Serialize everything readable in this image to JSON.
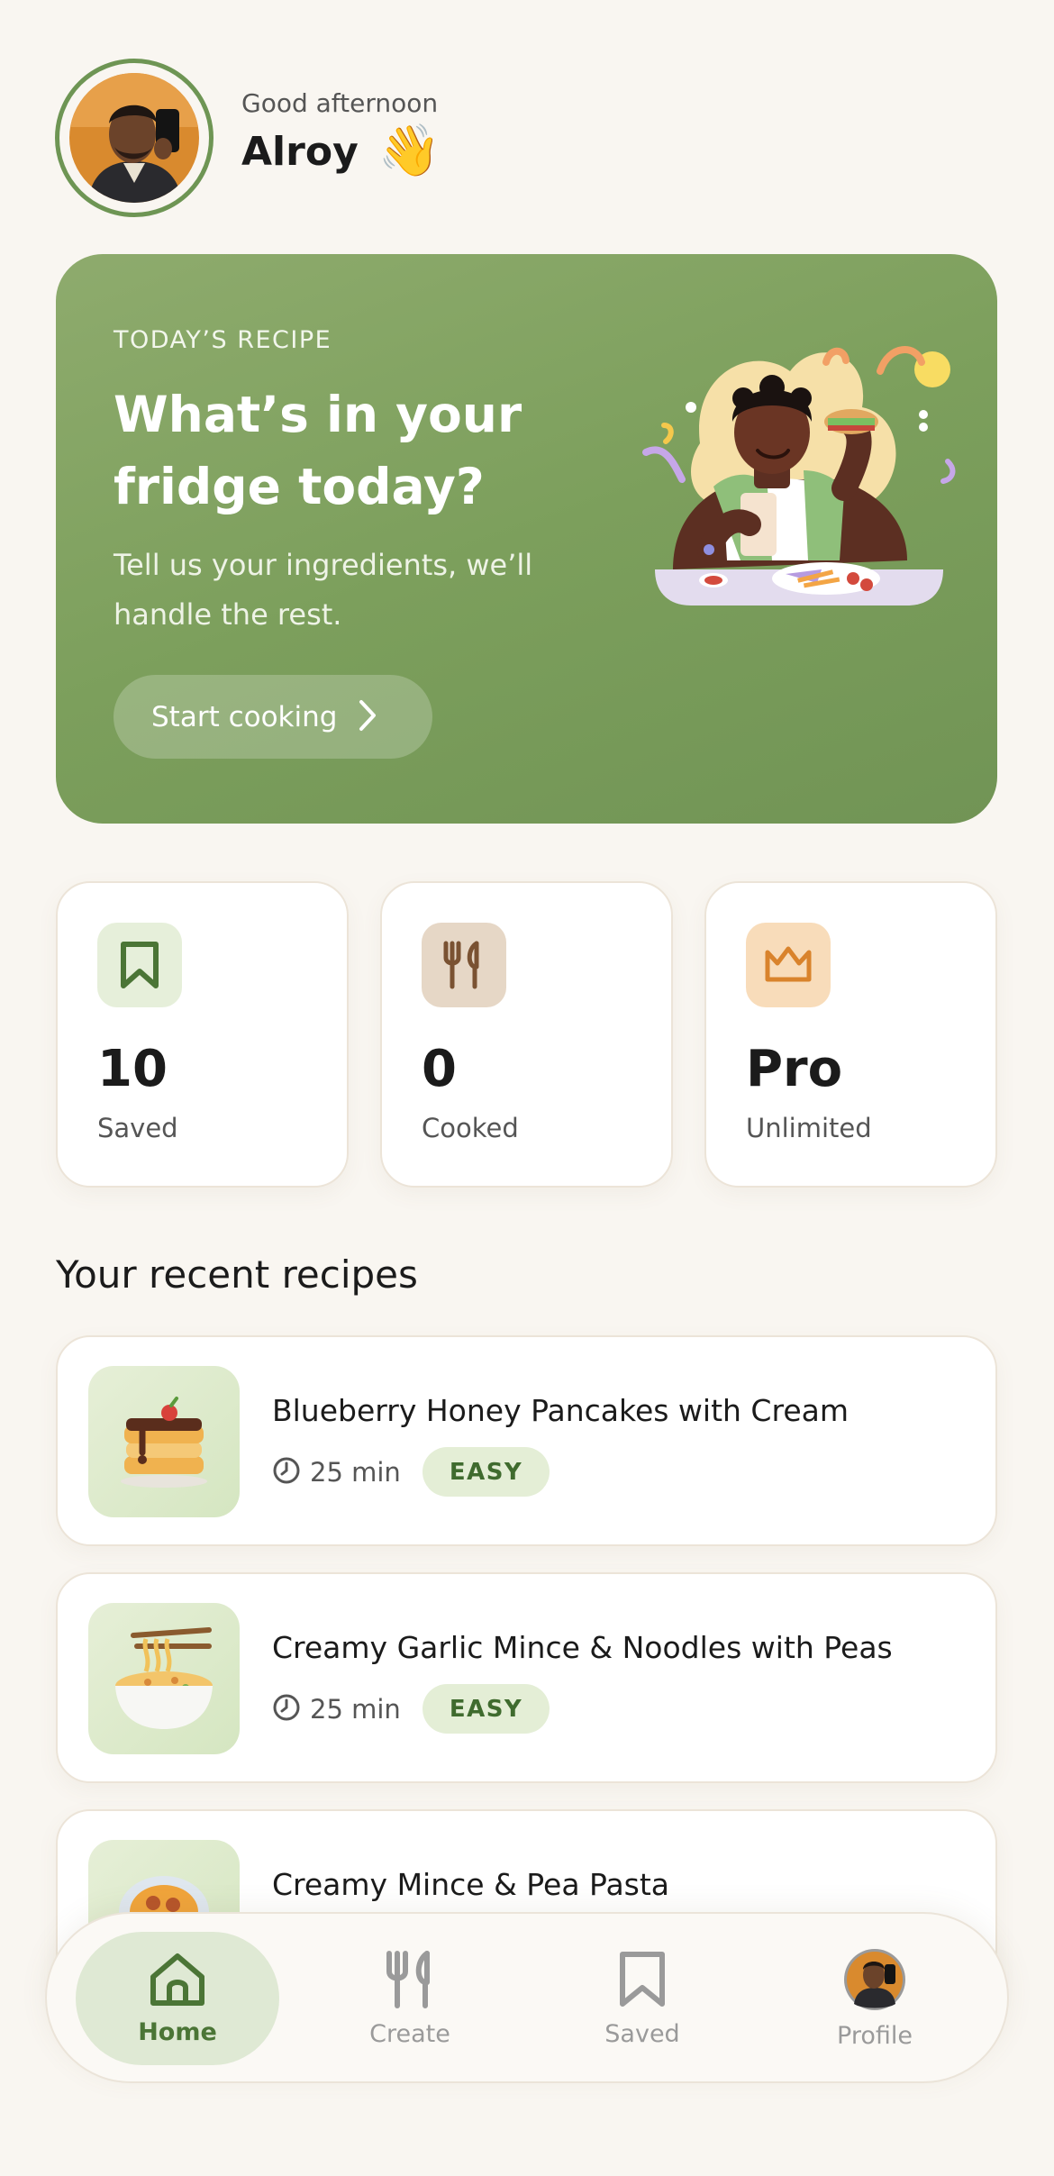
{
  "header": {
    "greeting": "Good afternoon",
    "user_name": "Alroy",
    "wave_emoji": "👋"
  },
  "hero": {
    "eyebrow": "TODAY’S RECIPE",
    "title": "What’s in your fridge today?",
    "subtitle": "Tell us your ingredients, we’ll handle the rest.",
    "cta_label": "Start cooking"
  },
  "stats": [
    {
      "icon": "bookmark-icon",
      "value": "10",
      "label": "Saved",
      "icon_bg": "#e6efda",
      "icon_color": "#4b7536"
    },
    {
      "icon": "utensils-icon",
      "value": "0",
      "label": "Cooked",
      "icon_bg": "#e6d7c6",
      "icon_color": "#7a5232"
    },
    {
      "icon": "crown-icon",
      "value": "Pro",
      "label": "Unlimited",
      "icon_bg": "#f8dcba",
      "icon_color": "#d9832c"
    }
  ],
  "recent": {
    "title": "Your recent recipes",
    "items": [
      {
        "title": "Blueberry Honey Pancakes with Cream",
        "time": "25 min",
        "difficulty": "EASY"
      },
      {
        "title": "Creamy Garlic Mince & Noodles with Peas",
        "time": "25 min",
        "difficulty": "EASY"
      },
      {
        "title": "Creamy Mince & Pea Pasta",
        "time": "",
        "difficulty": ""
      }
    ]
  },
  "nav": {
    "items": [
      {
        "label": "Home",
        "icon": "home-icon",
        "active": true
      },
      {
        "label": "Create",
        "icon": "utensils-icon",
        "active": false
      },
      {
        "label": "Saved",
        "icon": "bookmark-icon",
        "active": false
      },
      {
        "label": "Profile",
        "icon": "avatar",
        "active": false
      }
    ]
  },
  "colors": {
    "accent": "#6e9554",
    "hero_bg": "#7c9f5c",
    "page_bg": "#f9f6f1",
    "badge_bg": "#e4eed6",
    "badge_text": "#3f6b2e"
  }
}
